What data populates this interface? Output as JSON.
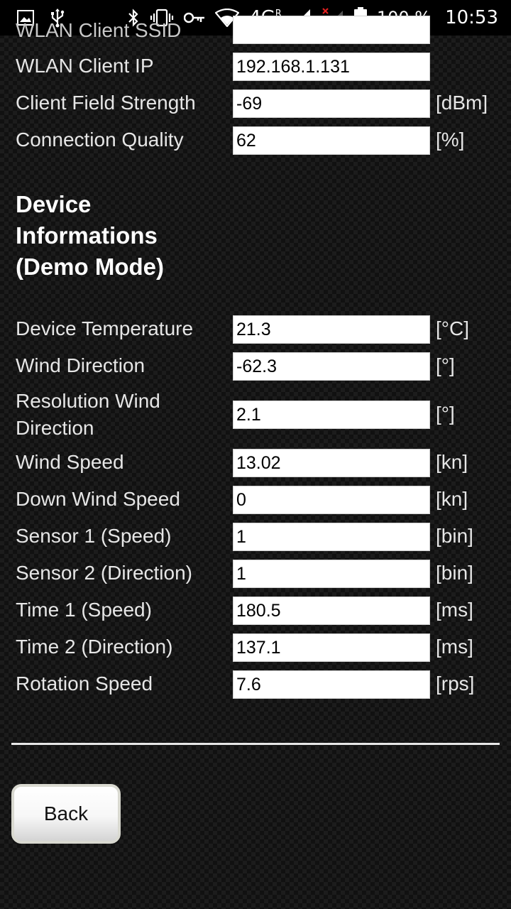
{
  "status_bar": {
    "icons": [
      "image-icon",
      "usb-icon",
      "bluetooth-icon",
      "vibrate-icon",
      "key-icon",
      "wifi-icon",
      "4g-signal-icon",
      "no-signal-icon",
      "battery-icon"
    ],
    "network_label": "4G",
    "network_superscript": "R",
    "battery_percent": "100 %",
    "time": "10:53"
  },
  "wlan": {
    "partial_label": "WLAN Client SSID",
    "partial_value": "",
    "rows": [
      {
        "label": "WLAN Client IP",
        "value": "192.168.1.131",
        "unit": ""
      },
      {
        "label": "Client Field Strength",
        "value": "-69",
        "unit": "[dBm]"
      },
      {
        "label": "Connection Quality",
        "value": "62",
        "unit": "[%]"
      }
    ]
  },
  "device": {
    "title": "Device Informations (Demo Mode)",
    "rows": [
      {
        "label": "Device Temperature",
        "value": "21.3",
        "unit": "[°C]"
      },
      {
        "label": "Wind Direction",
        "value": "-62.3",
        "unit": "[°]"
      },
      {
        "label": "Resolution Wind Direction",
        "value": "2.1",
        "unit": "[°]"
      },
      {
        "label": "Wind Speed",
        "value": "13.02",
        "unit": "[kn]"
      },
      {
        "label": "Down Wind Speed",
        "value": "0",
        "unit": "[kn]"
      },
      {
        "label": "Sensor 1 (Speed)",
        "value": "1",
        "unit": "[bin]"
      },
      {
        "label": "Sensor 2 (Direction)",
        "value": "1",
        "unit": "[bin]"
      },
      {
        "label": "Time 1 (Speed)",
        "value": "180.5",
        "unit": "[ms]"
      },
      {
        "label": "Time 2 (Direction)",
        "value": "137.1",
        "unit": "[ms]"
      },
      {
        "label": "Rotation Speed",
        "value": "7.6",
        "unit": "[rps]"
      }
    ]
  },
  "back_label": "Back"
}
